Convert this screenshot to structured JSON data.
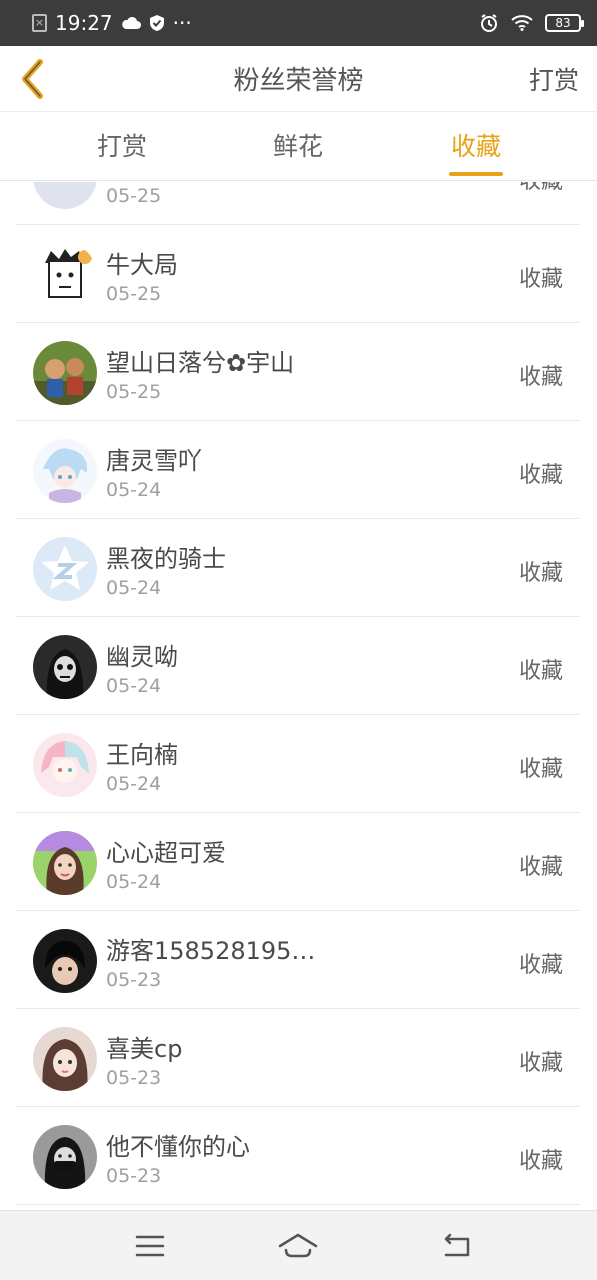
{
  "status_bar": {
    "time": "19:27",
    "dots": "···",
    "battery": "83"
  },
  "header": {
    "title": "粉丝荣誉榜",
    "right_action": "打赏"
  },
  "tabs": [
    {
      "label": "打赏",
      "active": false
    },
    {
      "label": "鲜花",
      "active": false
    },
    {
      "label": "收藏",
      "active": true
    }
  ],
  "list": [
    {
      "name": "",
      "date": "05-25",
      "action": "收藏"
    },
    {
      "name": "牛大局",
      "date": "05-25",
      "action": "收藏"
    },
    {
      "name": "望山日落兮✿宇山",
      "date": "05-25",
      "action": "收藏"
    },
    {
      "name": "唐灵雪吖",
      "date": "05-24",
      "action": "收藏"
    },
    {
      "name": "黑夜的骑士",
      "date": "05-24",
      "action": "收藏"
    },
    {
      "name": "幽灵呦",
      "date": "05-24",
      "action": "收藏"
    },
    {
      "name": "王向楠",
      "date": "05-24",
      "action": "收藏"
    },
    {
      "name": "心心超可爱",
      "date": "05-24",
      "action": "收藏"
    },
    {
      "name": "游客158528195…",
      "date": "05-23",
      "action": "收藏"
    },
    {
      "name": "喜美cp",
      "date": "05-23",
      "action": "收藏"
    },
    {
      "name": "他不懂你的心",
      "date": "05-23",
      "action": "收藏"
    }
  ],
  "nav_bar": {
    "icons": [
      "menu-icon",
      "home-icon",
      "back-icon"
    ]
  },
  "colors": {
    "accent": "#e8a317",
    "status_bar_bg": "#3c3c3c",
    "nav_bg": "#f3f3f3"
  }
}
